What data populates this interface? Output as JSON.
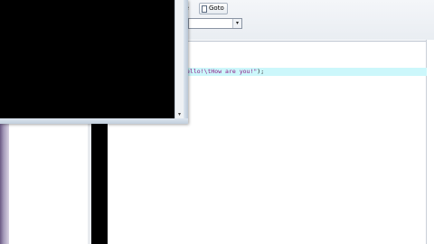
{
  "ide": {
    "toolbar": {
      "partial_button_label": "e",
      "goto_label": "Goto"
    },
    "scope_dropdown": {
      "selected": "",
      "arrow_icon": "chevron-down-icon"
    },
    "editor": {
      "code_visible": "ello!\\tHow are you!\");",
      "code_string": "ello!\\tHow are you!\"",
      "code_tail": ");",
      "highlight_color": "#ccf7fb"
    }
  },
  "console": {
    "output_text": "",
    "background_color": "#000000"
  }
}
